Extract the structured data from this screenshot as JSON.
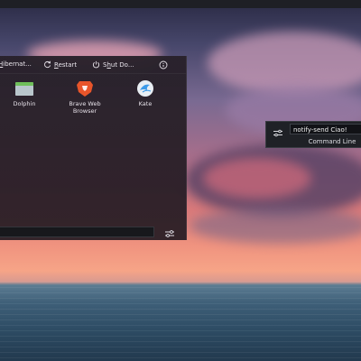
{
  "launcher": {
    "power": {
      "hibernate": {
        "prefix": "",
        "underlined": "H",
        "suffix": "ibernat..."
      },
      "restart": {
        "underlined": "R",
        "suffix": "estart"
      },
      "shutdown": {
        "prefix": "S",
        "underlined": "h",
        "suffix": "ut Do..."
      }
    },
    "apps": [
      {
        "label": "Dolphin",
        "icon": "dolphin-icon"
      },
      {
        "label": "Brave Web Browser",
        "icon": "brave-icon"
      },
      {
        "label": "Kate",
        "icon": "kate-icon"
      }
    ],
    "search_value": ""
  },
  "krunner": {
    "query": "notify-send Ciao!",
    "result": "Command Line"
  },
  "colors": {
    "panel_bg": "#2b2229",
    "accent_brave": "#e8552a",
    "accent_kate": "#3d9be9",
    "folder_green": "#6fbf5a"
  }
}
